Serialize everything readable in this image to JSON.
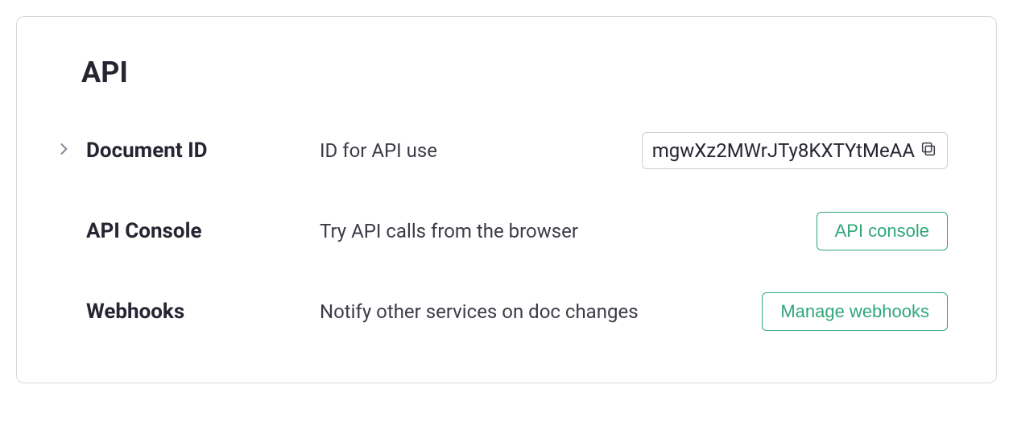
{
  "section": {
    "title": "API"
  },
  "rows": {
    "document_id": {
      "label": "Document ID",
      "description": "ID for API use",
      "value": "mgwXz2MWrJTy8KXTYtMeAA"
    },
    "api_console": {
      "label": "API Console",
      "description": "Try API calls from the browser",
      "button_label": "API console"
    },
    "webhooks": {
      "label": "Webhooks",
      "description": "Notify other services on doc changes",
      "button_label": "Manage webhooks"
    }
  }
}
